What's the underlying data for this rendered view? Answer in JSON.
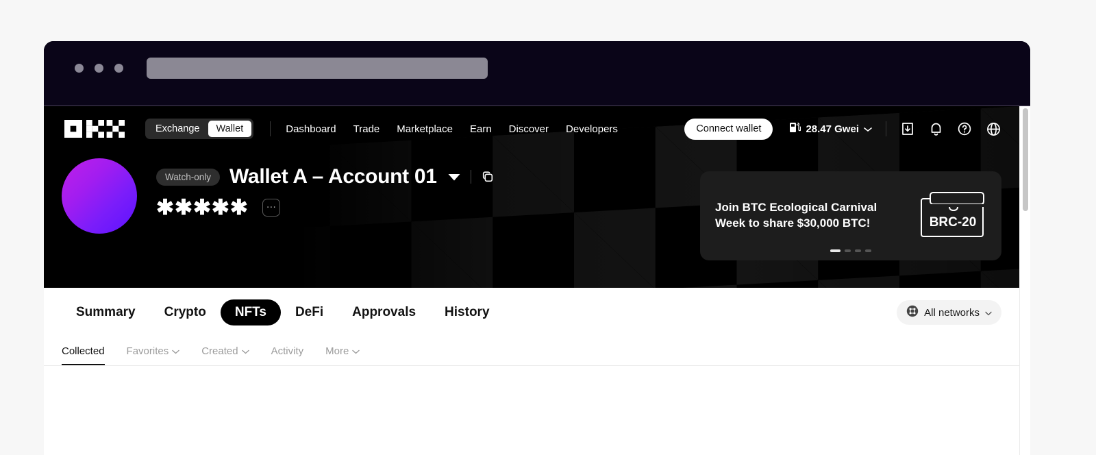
{
  "browser": {
    "traffic_lights": [
      "close",
      "minimize",
      "maximize"
    ],
    "url_value": "",
    "url_placeholder": ""
  },
  "topnav": {
    "logo_name": "okx-logo",
    "segmented": {
      "options": [
        "Exchange",
        "Wallet"
      ],
      "selected": "Wallet"
    },
    "links": [
      {
        "label": "Dashboard"
      },
      {
        "label": "Trade"
      },
      {
        "label": "Marketplace"
      },
      {
        "label": "Earn"
      },
      {
        "label": "Discover"
      },
      {
        "label": "Developers"
      }
    ],
    "connect_wallet_label": "Connect wallet",
    "gas": {
      "icon": "gas-pump-icon",
      "value": "28.47 Gwei"
    },
    "icons": [
      {
        "name": "download-icon"
      },
      {
        "name": "bell-icon"
      },
      {
        "name": "help-circle-icon"
      },
      {
        "name": "globe-icon"
      }
    ]
  },
  "wallet": {
    "badge": "Watch-only",
    "name": "Wallet A – Account 01",
    "balance_masked": "✱✱✱✱✱",
    "more_label": "…",
    "caret_icon": "chevron-down-icon",
    "copy_icon": "copy-icon"
  },
  "promo": {
    "line1": "Join BTC Ecological Carnival",
    "line2": "Week to share $30,000 BTC!",
    "art_label": "BRC-20",
    "dots": 4,
    "active_dot": 0
  },
  "main_tabs": [
    {
      "label": "Summary",
      "active": false
    },
    {
      "label": "Crypto",
      "active": false
    },
    {
      "label": "NFTs",
      "active": true
    },
    {
      "label": "DeFi",
      "active": false
    },
    {
      "label": "Approvals",
      "active": false
    },
    {
      "label": "History",
      "active": false
    }
  ],
  "network_selector": {
    "icon": "network-grid-icon",
    "label": "All networks",
    "caret": "▾"
  },
  "subtabs": [
    {
      "label": "Collected",
      "active": true,
      "has_caret": false
    },
    {
      "label": "Favorites",
      "active": false,
      "has_caret": true
    },
    {
      "label": "Created",
      "active": false,
      "has_caret": true
    },
    {
      "label": "Activity",
      "active": false,
      "has_caret": false
    },
    {
      "label": "More",
      "active": false,
      "has_caret": true
    }
  ],
  "colors": {
    "brand_black": "#000000",
    "chrome_navy": "#0a0518",
    "accent_white": "#ffffff",
    "promo_card": "#1d1d1d",
    "avatar_start": "#c020e8",
    "avatar_end": "#5b12ff"
  }
}
